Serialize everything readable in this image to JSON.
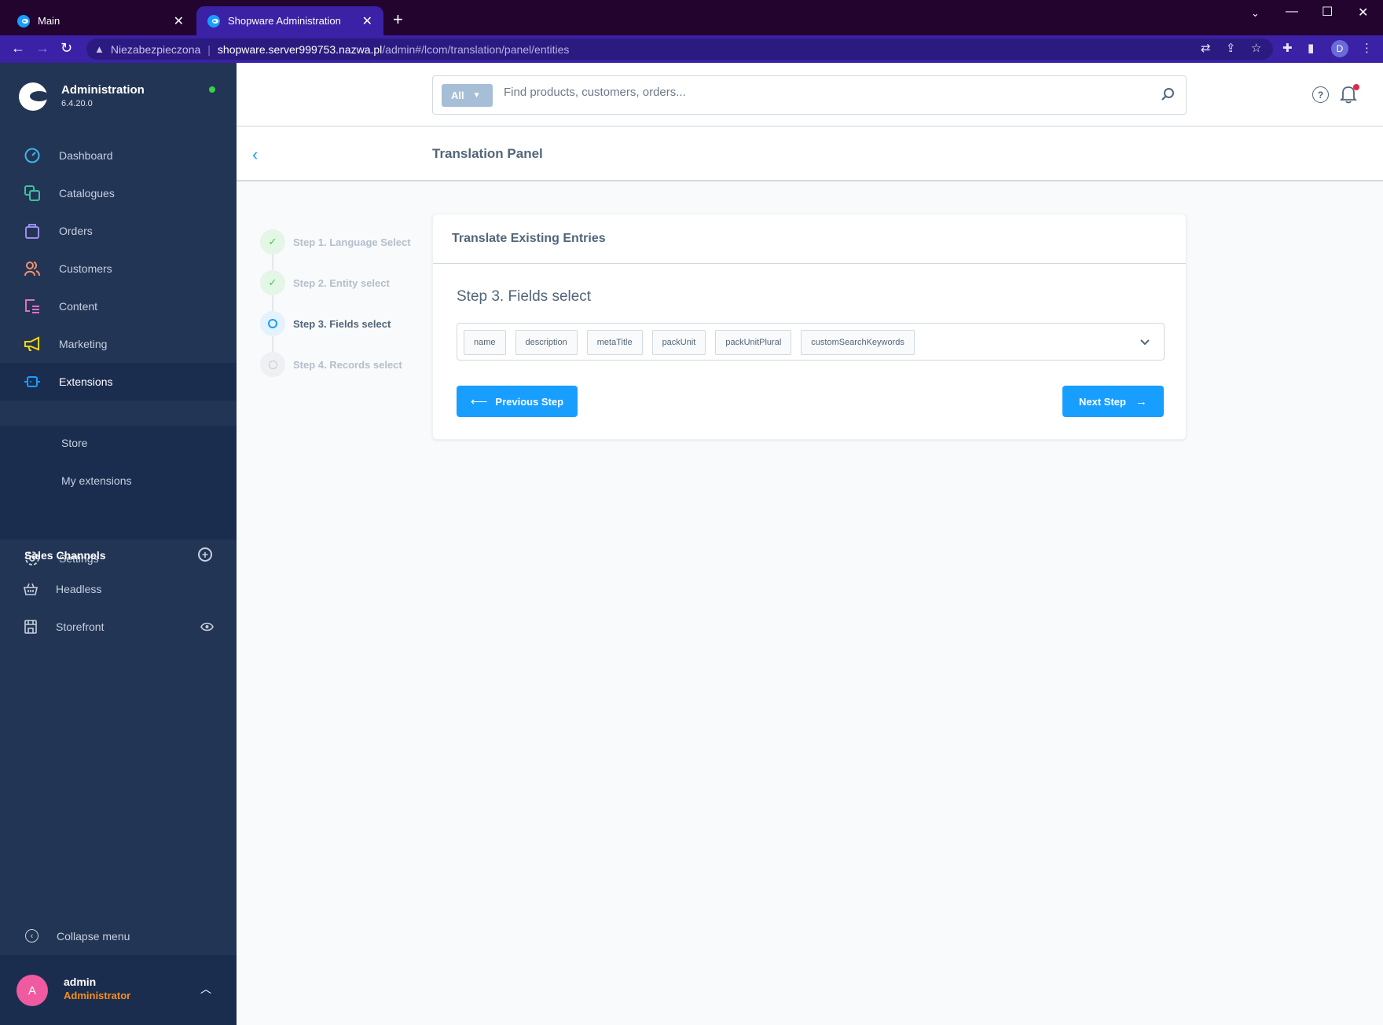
{
  "browser": {
    "tabs": [
      {
        "title": "Main",
        "active": false
      },
      {
        "title": "Shopware Administration",
        "active": true
      }
    ],
    "security_label": "Niezabezpieczona",
    "url_host": "shopware.server999753.nazwa.pl",
    "url_path": "/admin#/lcom/translation/panel/entities",
    "profile_initial": "D"
  },
  "sidebar": {
    "app_title": "Administration",
    "version": "6.4.20.0",
    "status_color": "#37d046",
    "items": [
      {
        "label": "Dashboard",
        "icon": "dashboard-icon",
        "color": "#3fb6e8"
      },
      {
        "label": "Catalogues",
        "icon": "catalogues-icon",
        "color": "#39c3a0"
      },
      {
        "label": "Orders",
        "icon": "orders-icon",
        "color": "#9b8ef0"
      },
      {
        "label": "Customers",
        "icon": "customers-icon",
        "color": "#f5926f"
      },
      {
        "label": "Content",
        "icon": "content-icon",
        "color": "#e070c6"
      },
      {
        "label": "Marketing",
        "icon": "marketing-icon",
        "color": "#ffd700"
      },
      {
        "label": "Extensions",
        "icon": "extensions-icon",
        "color": "#189eff",
        "active": true
      },
      {
        "label": "Settings",
        "icon": "settings-icon",
        "color": "#c6d0df"
      }
    ],
    "extensions_submenu": [
      {
        "label": "Store"
      },
      {
        "label": "My extensions"
      }
    ],
    "sales_channels_title": "Sales Channels",
    "sales_channels": [
      {
        "label": "Headless",
        "icon": "basket-icon"
      },
      {
        "label": "Storefront",
        "icon": "storefront-icon"
      }
    ],
    "collapse_label": "Collapse menu",
    "user": {
      "initial": "A",
      "name": "admin",
      "role": "Administrator"
    }
  },
  "header": {
    "search_type": "All",
    "search_placeholder": "Find products, customers, orders...",
    "help_glyph": "?"
  },
  "smartbar": {
    "title": "Translation Panel"
  },
  "steps": [
    {
      "label": "Step 1. Language Select",
      "state": "done"
    },
    {
      "label": "Step 2. Entity select",
      "state": "done"
    },
    {
      "label": "Step 3. Fields select",
      "state": "current"
    },
    {
      "label": "Step 4. Records select",
      "state": "pending"
    }
  ],
  "card": {
    "title": "Translate Existing Entries",
    "step_heading": "Step 3. Fields select",
    "selected_fields": [
      "name",
      "description",
      "metaTitle",
      "packUnit",
      "packUnitPlural",
      "customSearchKeywords"
    ],
    "prev_label": "Previous Step",
    "next_label": "Next Step"
  },
  "colors": {
    "primary": "#189eff",
    "sidebar_bg": "#233554",
    "browser_frame": "#3a21a6"
  }
}
